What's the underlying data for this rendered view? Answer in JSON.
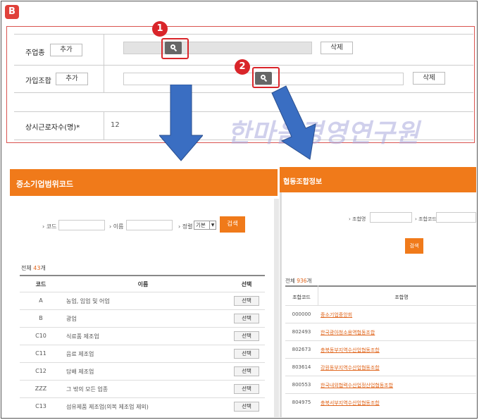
{
  "badge_b": "B",
  "top_form": {
    "rows": [
      {
        "label": "주업종",
        "add_label": "추가",
        "delete_label": "삭제"
      },
      {
        "label": "가입조합",
        "add_label": "추가",
        "delete_label": "삭제"
      },
      {
        "label": "상시근로자수(명)*",
        "value": "12"
      }
    ],
    "markers": [
      "1",
      "2"
    ]
  },
  "watermark": "한마음경영연구원",
  "left_panel": {
    "title": "중소기업범위코드",
    "search": {
      "code_label": "› 코드",
      "name_label": "› 이름",
      "sort_label": "› 정렬",
      "sort_value": "기본",
      "search_label": "검색"
    },
    "total_prefix": "전체 ",
    "total_count": "43",
    "total_suffix": "개",
    "columns": [
      "코드",
      "이름",
      "선택"
    ],
    "rows": [
      {
        "code": "A",
        "name": "농업, 임업 및 어업",
        "select": "선택"
      },
      {
        "code": "B",
        "name": "광업",
        "select": "선택"
      },
      {
        "code": "C10",
        "name": "식료품 제조업",
        "select": "선택"
      },
      {
        "code": "C11",
        "name": "음료 제조업",
        "select": "선택"
      },
      {
        "code": "C12",
        "name": "담배 제조업",
        "select": "선택"
      },
      {
        "code": "ZZZ",
        "name": "그 밖의 모든 업종",
        "select": "선택"
      },
      {
        "code": "C13",
        "name": "섬유제품 제조업(의복 제조업 제외)",
        "select": "선택"
      }
    ]
  },
  "right_panel": {
    "title": "협동조합정보",
    "search": {
      "name_label": "› 조합명",
      "code_label": "› 조합코드",
      "search_label": "검색"
    },
    "total_prefix": "전체 ",
    "total_count": "936",
    "total_suffix": "개",
    "columns": [
      "조합코드",
      "조합명"
    ],
    "rows": [
      {
        "code": "000000",
        "name": "중소기업중앙회"
      },
      {
        "code": "802493",
        "name": "한국광아청소용역협동조합"
      },
      {
        "code": "802673",
        "name": "충북동부지역수산업협동조합"
      },
      {
        "code": "803614",
        "name": "강원동부지역수산업협동조합"
      },
      {
        "code": "800553",
        "name": "한국내외협력수산업정산업협동조합"
      },
      {
        "code": "804975",
        "name": "충북서부지역수산업협동조합"
      }
    ]
  },
  "colors": {
    "accent": "#f07a1a",
    "marker": "#d9252a",
    "arrow": "#3a6ec2"
  }
}
